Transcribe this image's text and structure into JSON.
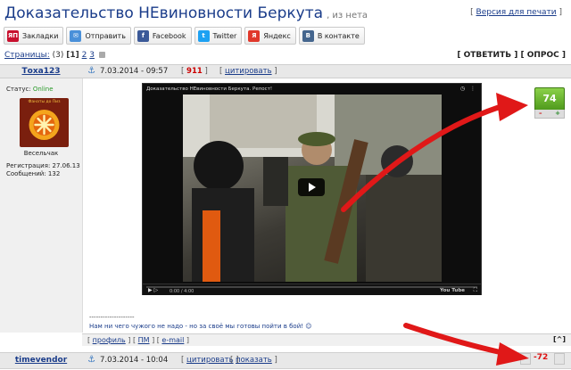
{
  "topic": {
    "title": "Доказательство НЕвиновности Беркута",
    "from": ", из нета",
    "print_bracket_open": "[ ",
    "print_link": "Версия для печати",
    "print_bracket_close": " ]"
  },
  "share": [
    {
      "icon": "bookmarks-icon",
      "badge": "ЯП",
      "color": "#c8102e",
      "label": "Закладки"
    },
    {
      "icon": "send-icon",
      "badge": "✉",
      "color": "#4a90d9",
      "label": "Отправить"
    },
    {
      "icon": "facebook-icon",
      "badge": "f",
      "color": "#3b5998",
      "label": "Facebook"
    },
    {
      "icon": "twitter-icon",
      "badge": "t",
      "color": "#1da1f2",
      "label": "Twitter"
    },
    {
      "icon": "yandex-icon",
      "badge": "Я",
      "color": "#e0382b",
      "label": "Яндекс"
    },
    {
      "icon": "vkontakte-icon",
      "badge": "В",
      "color": "#45668e",
      "label": "В контакте"
    }
  ],
  "pager": {
    "label": "Страницы:",
    "count": " (3) ",
    "current": "[1]",
    "p2": "2",
    "p3": "3"
  },
  "topic_actions": "[ ОТВЕТИТЬ ] [ ОПРОС ]",
  "post1": {
    "author": "Тоха123",
    "date": "7.03.2014 - 09:57",
    "ip_open": "[ ",
    "ip": "911",
    "ip_close": " ]",
    "quote_open": "[ ",
    "quote_link": "цитировать",
    "quote_close": " ]",
    "status_label": "Статус: ",
    "status": "Online",
    "avatar_text": "Фанаты до Пиз",
    "rank": "Весельчак",
    "registered": "Регистрация: 27.06.13",
    "messages": "Сообщений: 132",
    "video_title": "Доказательство НЕвиновности Беркута. Репост!",
    "video_time": "0:00 / 4:00",
    "video_brand": "You Tube",
    "rating": "74",
    "rating_minus": "–",
    "rating_plus": "+",
    "sig_line": "--------------------",
    "signature": "Нам ни чего чужого не надо - но за своё мы готовы пойти в бой! ☺",
    "f_profile": "профиль",
    "f_pm": "ПМ",
    "f_email": "e-mail",
    "to_top": "[^]"
  },
  "post2": {
    "author": "timevendor",
    "date": "7.03.2014 - 10:04",
    "quote_link": "цитировать",
    "show_link": "показать",
    "rating": "-72"
  }
}
